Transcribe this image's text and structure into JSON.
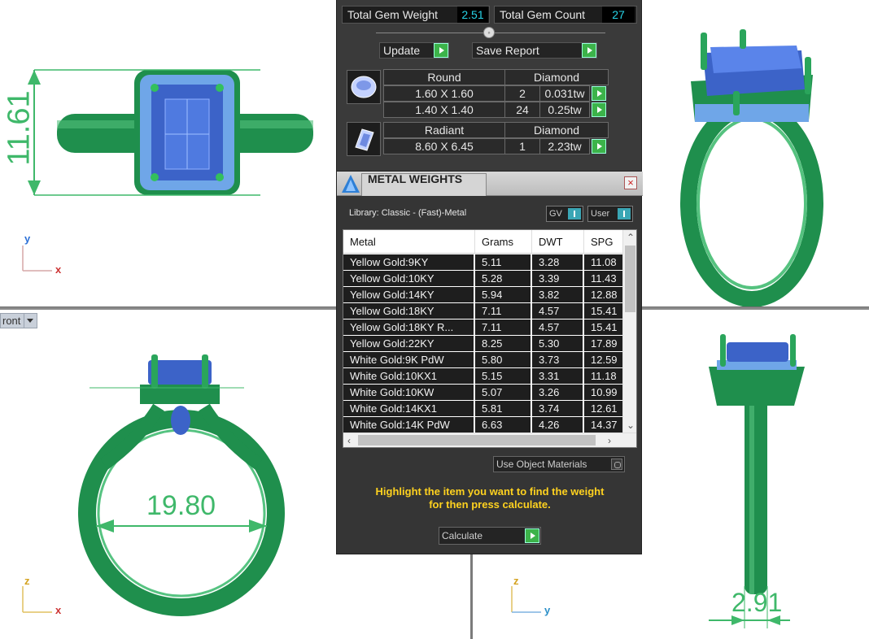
{
  "gem_report": {
    "total_gem_weight_label": "Total Gem Weight",
    "total_gem_weight": "2.51",
    "total_gem_count_label": "Total Gem Count",
    "total_gem_count": "27",
    "update_label": "Update",
    "save_report_label": "Save Report",
    "groups": [
      {
        "shape": "Round",
        "material": "Diamond",
        "rows": [
          {
            "size": "1.60 X 1.60",
            "count": "2",
            "weight": "0.031tw"
          },
          {
            "size": "1.40 X 1.40",
            "count": "24",
            "weight": "0.25tw"
          }
        ]
      },
      {
        "shape": "Radiant",
        "material": "Diamond",
        "rows": [
          {
            "size": "8.60 X 6.45",
            "count": "1",
            "weight": "2.23tw"
          }
        ]
      }
    ]
  },
  "metal_weights": {
    "title": "METAL WEIGHTS",
    "close": "×",
    "library": "Library: Classic - (Fast)-Metal",
    "toggle_gv": "GV",
    "toggle_user": "User",
    "columns": [
      "Metal",
      "Grams",
      "DWT",
      "SPG"
    ],
    "rows": [
      {
        "metal": "Yellow Gold:9KY",
        "grams": "5.11",
        "dwt": "3.28",
        "spg": "11.08"
      },
      {
        "metal": "Yellow Gold:10KY",
        "grams": "5.28",
        "dwt": "3.39",
        "spg": "11.43"
      },
      {
        "metal": "Yellow Gold:14KY",
        "grams": "5.94",
        "dwt": "3.82",
        "spg": "12.88"
      },
      {
        "metal": "Yellow Gold:18KY",
        "grams": "7.11",
        "dwt": "4.57",
        "spg": "15.41"
      },
      {
        "metal": "Yellow Gold:18KY R...",
        "grams": "7.11",
        "dwt": "4.57",
        "spg": "15.41"
      },
      {
        "metal": "Yellow Gold:22KY",
        "grams": "8.25",
        "dwt": "5.30",
        "spg": "17.89"
      },
      {
        "metal": "White Gold:9K PdW",
        "grams": "5.80",
        "dwt": "3.73",
        "spg": "12.59"
      },
      {
        "metal": "White Gold:10KX1",
        "grams": "5.15",
        "dwt": "3.31",
        "spg": "11.18"
      },
      {
        "metal": "White Gold:10KW",
        "grams": "5.07",
        "dwt": "3.26",
        "spg": "10.99"
      },
      {
        "metal": "White Gold:14KX1",
        "grams": "5.81",
        "dwt": "3.74",
        "spg": "12.61"
      },
      {
        "metal": "White Gold:14K PdW",
        "grams": "6.63",
        "dwt": "4.26",
        "spg": "14.37"
      }
    ],
    "use_object_materials": "Use Object Materials",
    "hint_line1": "Highlight the item you want to find the weight",
    "hint_line2": "for then press calculate.",
    "calculate": "Calculate"
  },
  "viewports": {
    "top_dimension": "11.61",
    "front_dimension": "19.80",
    "right_dimension": "2.91",
    "front_label": "ront",
    "axis_y": "y",
    "axis_x": "x",
    "axis_z": "z"
  },
  "colors": {
    "ring_green": "#1f8f4d",
    "dim_green": "#3fb86a",
    "gem_blue": "#3c63c8",
    "accent_yellow": "#ffd21f",
    "value_cyan": "#27d4e8"
  }
}
